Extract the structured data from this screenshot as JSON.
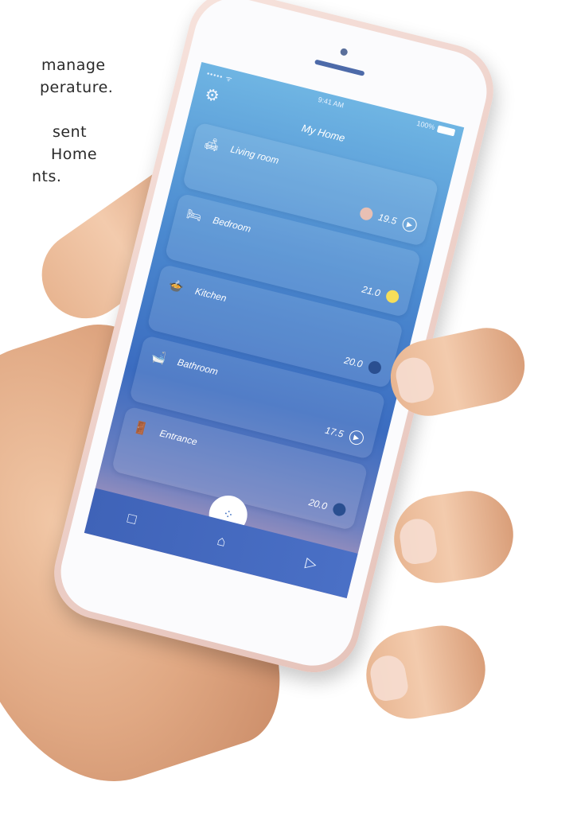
{
  "caption": {
    "lines": [
      "manage",
      "perature.",
      "sent",
      "Home",
      "nts."
    ]
  },
  "status_bar": {
    "signal": "••••• ᯤ",
    "time": "9:41 AM",
    "battery": "100%"
  },
  "app": {
    "title": "My Home"
  },
  "rooms": [
    {
      "name": "Living room",
      "icon": "sofa-icon",
      "temperature": "19.5",
      "mode": "play-icon"
    },
    {
      "name": "Bedroom",
      "icon": "bed-icon",
      "temperature": "21.0",
      "mode": "bulb-icon"
    },
    {
      "name": "Kitchen",
      "icon": "pot-icon",
      "temperature": "20.0",
      "mode": "drop-icon"
    },
    {
      "name": "Bathroom",
      "icon": "bath-icon",
      "temperature": "17.5",
      "mode": "play-icon"
    },
    {
      "name": "Entrance",
      "icon": "door-icon",
      "temperature": "20.0",
      "mode": "drop-icon"
    }
  ],
  "tabbar": {
    "items": [
      "square-icon",
      "home-icon",
      "play-icon"
    ]
  },
  "colors": {
    "accent": "#3b6cc0",
    "screen_top": "#6fb5e3",
    "screen_bottom": "#c9a1b9"
  }
}
